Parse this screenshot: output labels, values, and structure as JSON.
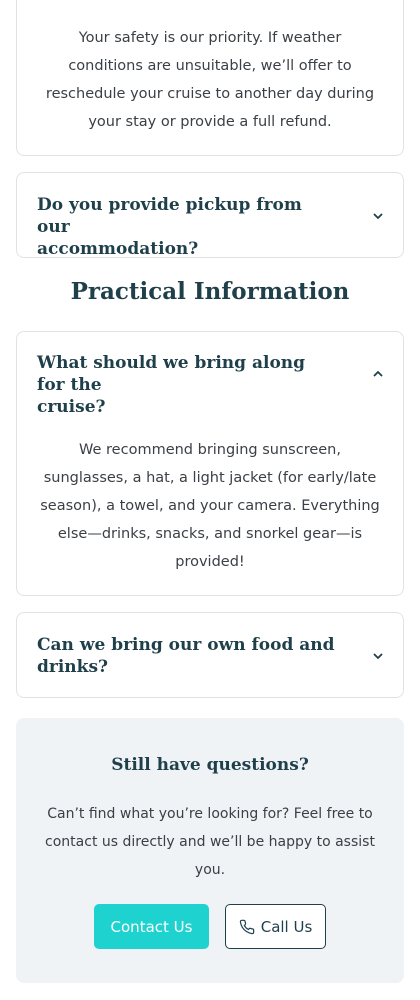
{
  "faq": {
    "items": [
      {
        "question": "",
        "answer_lines": [
          "Your safety is our priority. If weather",
          "conditions are unsuitable, we’ll offer to",
          "reschedule your cruise to another day during",
          "your stay or provide a full refund."
        ],
        "expanded": true
      },
      {
        "question_lines": [
          "Do you provide pickup from our",
          "accommodation?"
        ],
        "expanded": false,
        "icon": "chevron-down-icon"
      }
    ]
  },
  "practical": {
    "section_title": "Practical Information",
    "items": [
      {
        "question_lines": [
          "What should we bring along for the",
          "cruise?"
        ],
        "expanded": true,
        "icon": "chevron-up-icon",
        "answer_lines": [
          "We recommend bringing sunscreen,",
          "sunglasses, a hat, a light jacket (for early/late",
          "season), a towel, and your camera. Everything",
          "else—drinks, snacks, and snorkel gear—is",
          "provided!"
        ]
      },
      {
        "question_lines": [
          "Can we bring our own food and",
          "drinks?"
        ],
        "expanded": false,
        "icon": "chevron-down-icon"
      }
    ]
  },
  "cta": {
    "title": "Still have questions?",
    "text_lines": [
      "Can’t find what you’re looking for? Feel free to",
      "contact us directly and we’ll be happy to assist",
      "you."
    ],
    "contact_label": "Contact Us",
    "call_label": "Call Us",
    "call_icon": "phone-icon"
  },
  "colors": {
    "heading": "#1f3f4a",
    "accent": "#1ed3cf",
    "cta_background": "#f0f3f5",
    "border": "#dfe3e6"
  }
}
